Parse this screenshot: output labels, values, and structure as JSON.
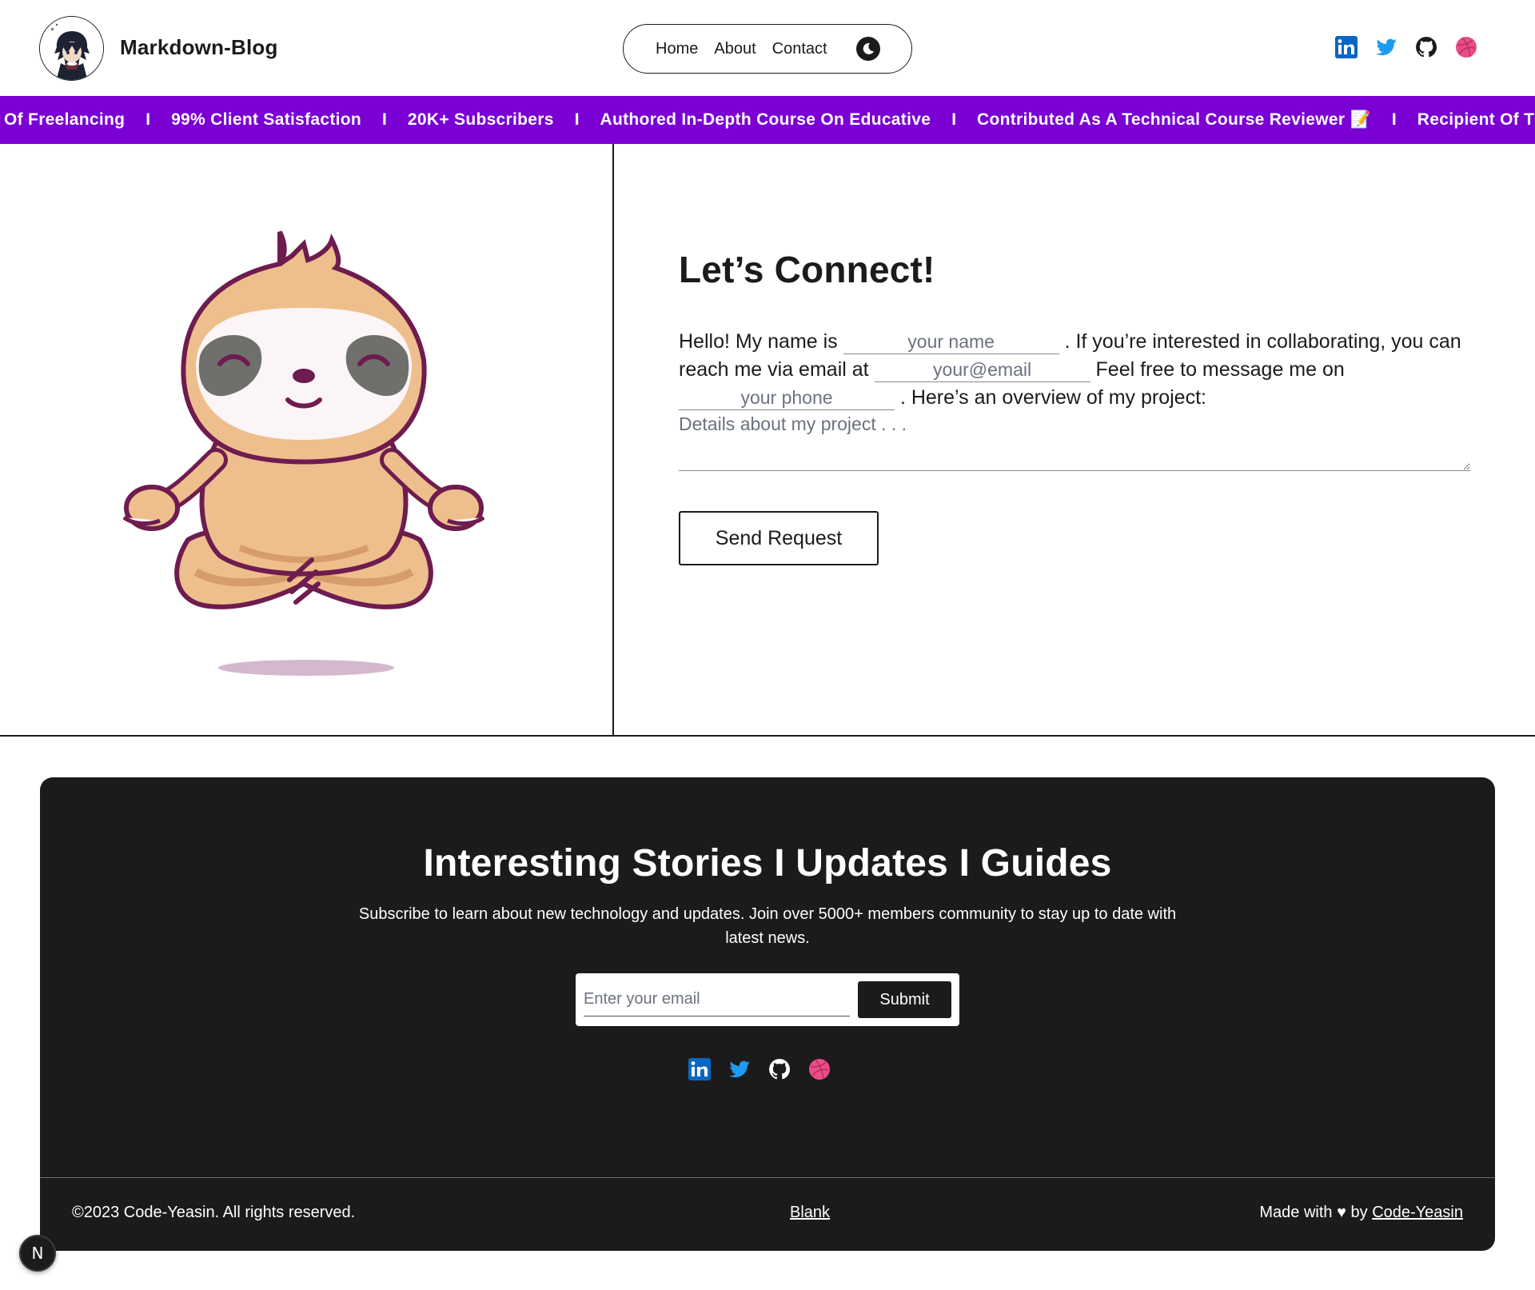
{
  "header": {
    "title": "Markdown-Blog",
    "nav": [
      {
        "label": "Home"
      },
      {
        "label": "About"
      },
      {
        "label": "Contact"
      }
    ],
    "socials": [
      "linkedin-icon",
      "twitter-icon",
      "github-icon",
      "dribbble-icon"
    ]
  },
  "marquee": {
    "items": [
      "Of Freelancing",
      "99% Client Satisfaction",
      "20K+ Subscribers",
      "Authored In-Depth Course On Educative",
      "Contributed As A Technical Course Reviewer 📝",
      "Recipient Of Th"
    ],
    "separator": "I"
  },
  "contact": {
    "title": "Let’s Connect!",
    "text1": "Hello! My name is",
    "name_placeholder": "your name",
    "text2": ". If you’re interested in collaborating, you can reach me via email at",
    "email_placeholder": "your@email",
    "text3": "Feel free to message me on",
    "phone_placeholder": "your phone",
    "text4": ". Here’s an overview of my project:",
    "details_placeholder": "Details about my project . . .",
    "send_label": "Send Request"
  },
  "footer": {
    "title": "Interesting Stories I Updates I Guides",
    "description": "Subscribe to learn about new technology and updates. Join over 5000+ members community to stay up to date with latest news.",
    "email_placeholder": "Enter your email",
    "submit_label": "Submit",
    "copyright": "©2023 Code-Yeasin. All rights reserved.",
    "blank_link": "Blank",
    "made_with_prefix": "Made with ♥ by",
    "made_with_author": "Code-Yeasin"
  },
  "badge": {
    "label": "N"
  },
  "colors": {
    "marquee_bg": "#7b00d4",
    "footer_bg": "#1b1b1b",
    "linkedin": "#0a66c2",
    "twitter": "#1d9bf0",
    "dribbble": "#ea4c89"
  }
}
